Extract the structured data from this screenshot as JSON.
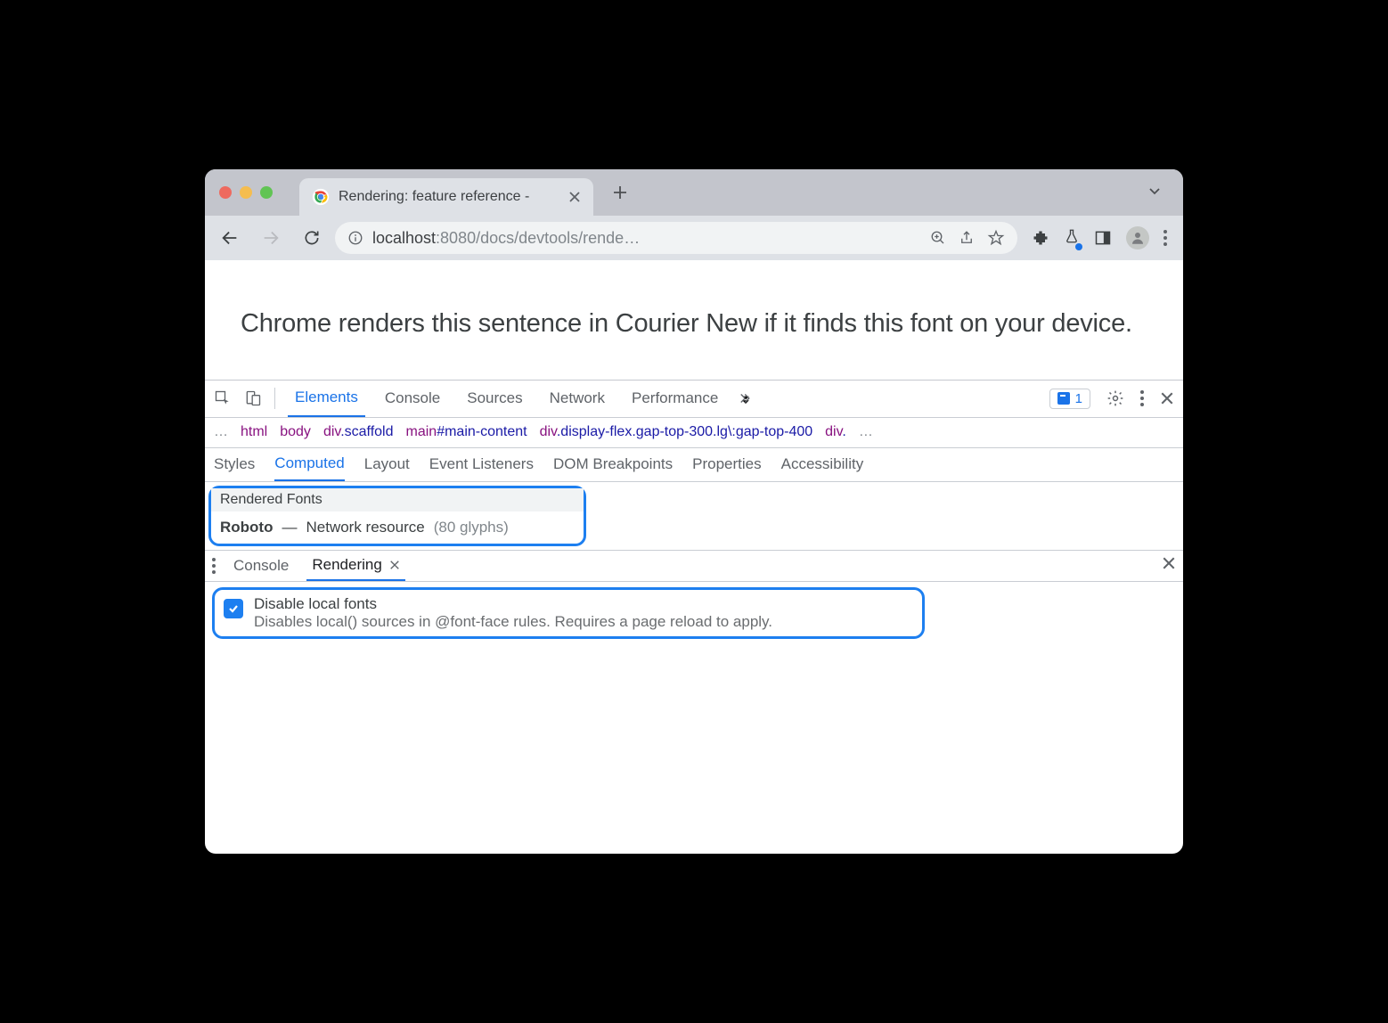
{
  "window": {
    "tab_title": "Rendering: feature reference -",
    "url_host_prefix": "localhost",
    "url_port_path": ":8080/docs/devtools/rende…"
  },
  "page": {
    "body_text": "Chrome renders this sentence in Courier New if it finds this font on your device."
  },
  "devtools": {
    "main_tabs": [
      "Elements",
      "Console",
      "Sources",
      "Network",
      "Performance"
    ],
    "issues_count": "1",
    "breadcrumb": {
      "ellipsis_left": "…",
      "items": [
        {
          "tag": "html",
          "rest": ""
        },
        {
          "tag": "body",
          "rest": ""
        },
        {
          "tag": "div",
          "rest": ".scaffold"
        },
        {
          "tag": "main",
          "rest": "#main-content"
        },
        {
          "tag": "div",
          "rest": ".display-flex.gap-top-300.lg\\:gap-top-400"
        },
        {
          "tag": "div",
          "rest": "."
        }
      ],
      "ellipsis_right": "…"
    },
    "subtabs": [
      "Styles",
      "Computed",
      "Layout",
      "Event Listeners",
      "DOM Breakpoints",
      "Properties",
      "Accessibility"
    ],
    "rendered_fonts": {
      "header": "Rendered Fonts",
      "font_name": "Roboto",
      "dash": "—",
      "source": "Network resource",
      "glyphs": "(80 glyphs)"
    },
    "drawer_tabs": [
      "Console",
      "Rendering"
    ],
    "option": {
      "title": "Disable local fonts",
      "desc": "Disables local() sources in @font-face rules. Requires a page reload to apply."
    }
  }
}
